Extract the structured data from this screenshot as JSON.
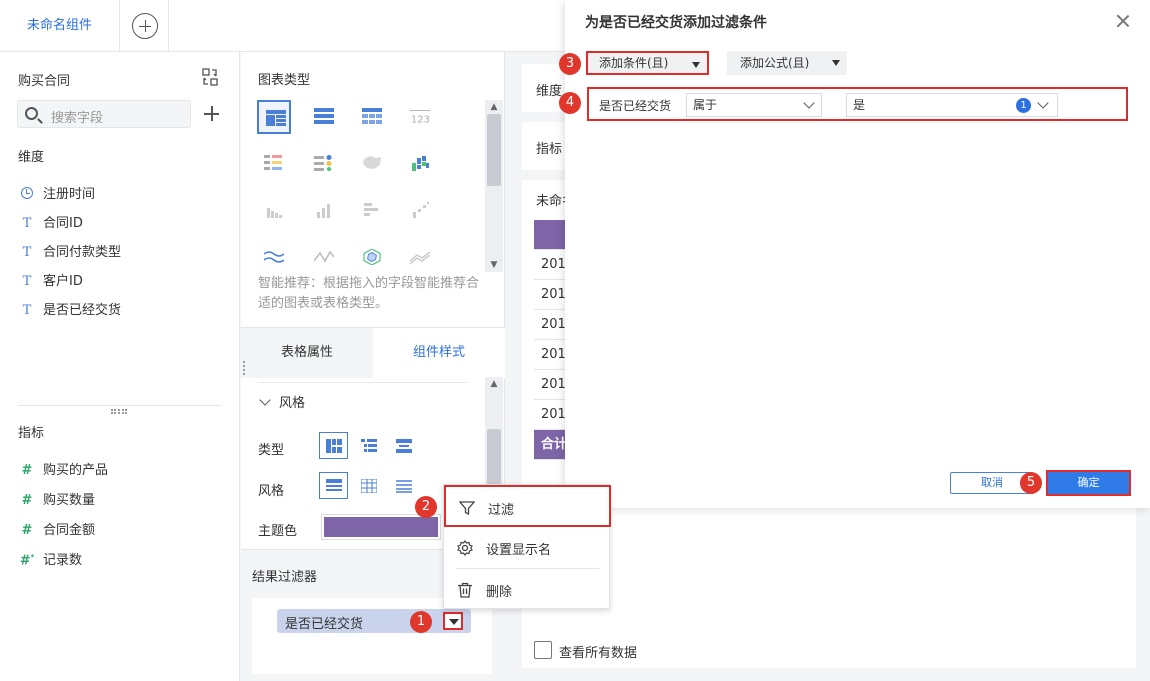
{
  "tabs": {
    "active_label": "未命名组件"
  },
  "field_panel": {
    "title": "购买合同",
    "search_placeholder": "搜索字段",
    "dimension_header": "维度",
    "dimensions": [
      {
        "label": "注册时间",
        "icon": "clock-icon"
      },
      {
        "label": "合同ID",
        "icon": "text-type-icon"
      },
      {
        "label": "合同付款类型",
        "icon": "text-type-icon"
      },
      {
        "label": "客户ID",
        "icon": "text-type-icon"
      },
      {
        "label": "是否已经交货",
        "icon": "text-type-icon"
      }
    ],
    "metric_header": "指标",
    "metrics": [
      {
        "label": "购买的产品",
        "icon": "hash-icon"
      },
      {
        "label": "购买数量",
        "icon": "hash-icon"
      },
      {
        "label": "合同金额",
        "icon": "hash-icon"
      },
      {
        "label": "记录数",
        "icon": "hash-star-icon"
      }
    ]
  },
  "config_panel": {
    "chart_type_title": "图表类型",
    "hint": "智能推荐：根据拖入的字段智能推荐合适的图表或表格类型。",
    "tab_table_props": "表格属性",
    "tab_component_style": "组件样式",
    "style_section": "风格",
    "type_label": "类型",
    "style_label": "风格",
    "theme_color_label": "主题色",
    "theme_color": "#7e65a8",
    "result_filter_title": "结果过滤器",
    "filter_chip_label": "是否已经交货"
  },
  "context_menu": {
    "items": [
      {
        "label": "过滤",
        "icon": "filter-icon"
      },
      {
        "label": "设置显示名",
        "icon": "gear-icon"
      },
      {
        "label": "删除",
        "icon": "trash-icon"
      }
    ]
  },
  "preview": {
    "dimension_label": "维度",
    "metric_label": "指标",
    "table_title_partial": "未命名",
    "rows": [
      "201",
      "201",
      "201",
      "201",
      "201",
      "201"
    ],
    "footer_partial": "合计",
    "view_all_label": "查看所有数据"
  },
  "dialog": {
    "title": "为是否已经交货添加过滤条件",
    "add_condition_label": "添加条件(且)",
    "add_formula_label": "添加公式(且)",
    "condition": {
      "field": "是否已经交货",
      "operator": "属于",
      "value": "是",
      "value_count": "1"
    },
    "cancel_label": "取消",
    "ok_label": "确定"
  },
  "badges": [
    "1",
    "2",
    "3",
    "4",
    "5"
  ],
  "colors": {
    "accent": "#2b6fe0",
    "highlight": "#e02b2b",
    "theme": "#7e65a8"
  }
}
